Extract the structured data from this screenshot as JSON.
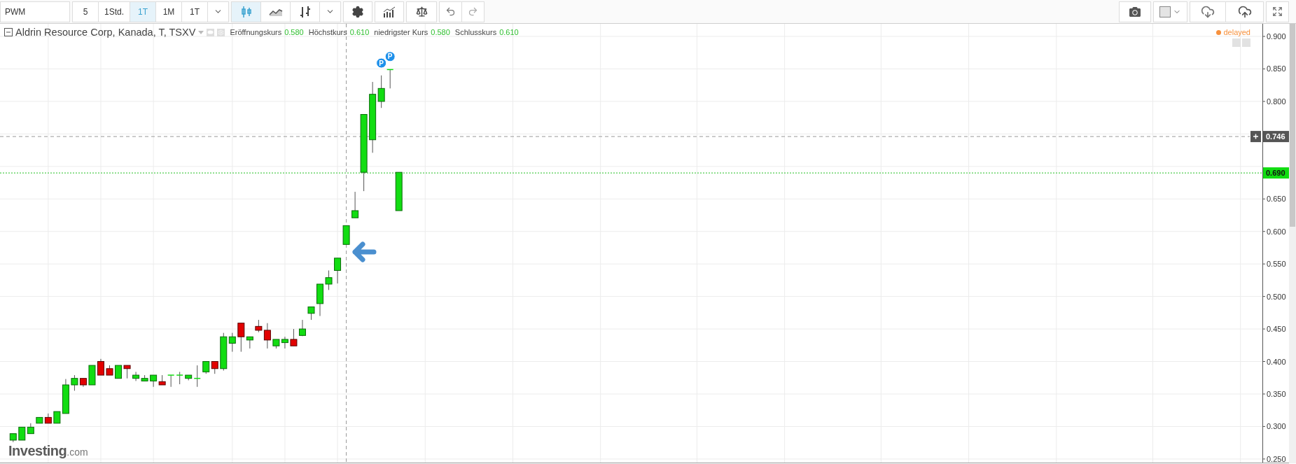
{
  "toolbar": {
    "symbol": "PWM",
    "intervals": [
      {
        "label": "5",
        "selected": false
      },
      {
        "label": "1Std.",
        "selected": false
      },
      {
        "label": "1T",
        "selected": true
      },
      {
        "label": "1M",
        "selected": false
      },
      {
        "label": "1T",
        "selected": false
      }
    ],
    "chart_types": [
      {
        "kind": "candles",
        "selected": true
      },
      {
        "kind": "line",
        "selected": false
      },
      {
        "kind": "bars",
        "selected": false
      }
    ]
  },
  "legend": {
    "title": "Aldrin Resource Corp, Kanada, T, TSXV",
    "fields": [
      {
        "label": "Eröffnungskurs",
        "value": "0.580"
      },
      {
        "label": "Höchstkurs",
        "value": "0.610"
      },
      {
        "label": "niedrigster Kurs",
        "value": "0.580"
      },
      {
        "label": "Schlusskurs",
        "value": "0.610"
      }
    ]
  },
  "status": {
    "label": "delayed",
    "color": "#f7913d"
  },
  "logo": {
    "name": "Investing",
    "suffix": ".com"
  },
  "chart_data": {
    "type": "candlestick",
    "grid": true,
    "ylim": [
      0.2434,
      0.9194
    ],
    "categories": [
      null,
      null,
      null,
      null,
      null,
      null,
      null,
      null,
      null,
      null,
      null,
      null,
      null,
      null,
      null,
      null,
      null,
      null,
      null,
      null,
      null,
      null,
      null,
      null,
      null,
      null,
      null,
      null,
      null,
      null,
      null,
      null,
      null,
      null,
      null,
      null,
      null,
      null,
      null,
      null,
      null,
      null,
      null,
      null,
      null,
      null,
      null,
      null,
      null,
      null,
      null,
      null,
      null,
      null,
      null,
      null,
      null,
      null,
      null,
      null,
      null,
      null,
      null,
      null,
      null,
      null,
      null,
      null,
      null,
      null,
      null,
      null,
      null,
      null,
      null,
      null,
      null,
      null,
      null,
      null,
      null,
      null,
      null,
      null,
      null,
      null,
      null,
      null,
      null,
      null,
      null,
      null,
      null,
      null,
      null,
      null,
      null,
      null,
      null,
      null,
      null,
      null,
      null,
      null,
      null,
      null,
      null,
      null,
      null,
      null,
      null,
      null,
      null,
      null,
      null,
      null,
      null,
      null,
      null,
      null,
      null,
      null,
      null,
      null,
      null,
      null,
      null,
      null,
      null,
      null,
      null,
      null,
      null,
      null,
      null,
      null,
      null,
      null,
      null,
      null,
      null,
      null,
      null,
      null
    ],
    "yticks": [
      {
        "value": 0.9,
        "label": "0.900"
      },
      {
        "value": 0.85,
        "label": "0.850"
      },
      {
        "value": 0.8,
        "label": "0.800"
      },
      {
        "value": 0.65,
        "label": "0.650"
      },
      {
        "value": 0.6,
        "label": "0.600"
      },
      {
        "value": 0.55,
        "label": "0.550"
      },
      {
        "value": 0.5,
        "label": "0.500"
      },
      {
        "value": 0.45,
        "label": "0.450"
      },
      {
        "value": 0.4,
        "label": "0.400"
      },
      {
        "value": 0.35,
        "label": "0.350"
      },
      {
        "value": 0.3,
        "label": "0.300"
      },
      {
        "value": 0.25,
        "label": "0.250"
      }
    ],
    "ohlc": [
      null,
      [
        0.279,
        0.289,
        0.276,
        0.289
      ],
      [
        0.279,
        0.299,
        0.279,
        0.299
      ],
      [
        0.289,
        0.305,
        0.289,
        0.299
      ],
      [
        0.305,
        0.314,
        0.305,
        0.314
      ],
      [
        0.314,
        0.32,
        0.305,
        0.305
      ],
      [
        0.305,
        0.323,
        0.305,
        0.323
      ],
      [
        0.32,
        0.373,
        0.32,
        0.364
      ],
      [
        0.364,
        0.379,
        0.355,
        0.374
      ],
      [
        0.374,
        0.374,
        0.361,
        0.364
      ],
      [
        0.364,
        0.394,
        0.364,
        0.394
      ],
      [
        0.4,
        0.404,
        0.379,
        0.379
      ],
      [
        0.389,
        0.394,
        0.379,
        0.379
      ],
      [
        0.374,
        0.394,
        0.374,
        0.394
      ],
      [
        0.394,
        0.394,
        0.374,
        0.389
      ],
      [
        0.374,
        0.384,
        0.37,
        0.379
      ],
      [
        0.37,
        0.379,
        0.37,
        0.374
      ],
      [
        0.37,
        0.379,
        0.361,
        0.379
      ],
      [
        0.369,
        0.379,
        0.364,
        0.364
      ],
      [
        0.379,
        0.379,
        0.361,
        0.379
      ],
      [
        0.379,
        0.384,
        0.365,
        0.379
      ],
      [
        0.374,
        0.379,
        0.371,
        0.379
      ],
      [
        0.374,
        0.394,
        0.361,
        0.374
      ],
      [
        0.384,
        0.4,
        0.381,
        0.4
      ],
      [
        0.4,
        0.4,
        0.381,
        0.389
      ],
      [
        0.389,
        0.444,
        0.386,
        0.438
      ],
      [
        0.428,
        0.444,
        0.415,
        0.438
      ],
      [
        0.459,
        0.459,
        0.415,
        0.438
      ],
      [
        0.433,
        0.438,
        0.42,
        0.438
      ],
      [
        0.454,
        0.464,
        0.445,
        0.448
      ],
      [
        0.448,
        0.459,
        0.42,
        0.433
      ],
      [
        0.424,
        0.434,
        0.42,
        0.434
      ],
      [
        0.429,
        0.438,
        0.42,
        0.434
      ],
      [
        0.434,
        0.45,
        0.424,
        0.424
      ],
      [
        0.44,
        0.464,
        0.439,
        0.45
      ],
      [
        0.474,
        0.484,
        0.464,
        0.484
      ],
      [
        0.489,
        0.519,
        0.47,
        0.519
      ],
      [
        0.519,
        0.54,
        0.51,
        0.529
      ],
      [
        0.54,
        0.559,
        0.52,
        0.559
      ],
      [
        0.58,
        0.609,
        0.58,
        0.609
      ],
      [
        0.621,
        0.661,
        0.621,
        0.632
      ],
      [
        0.691,
        0.78,
        0.662,
        0.78
      ],
      [
        0.741,
        0.83,
        0.721,
        0.811
      ],
      [
        0.8,
        0.84,
        0.79,
        0.82
      ],
      [
        0.849,
        0.849,
        0.82,
        0.849
      ],
      [
        0.632,
        0.691,
        0.632,
        0.691
      ],
      null,
      null,
      null,
      null,
      null,
      null,
      null,
      null,
      null,
      null,
      null,
      null,
      null,
      null,
      null,
      null,
      null,
      null,
      null,
      null,
      null,
      null,
      null,
      null,
      null,
      null,
      null,
      null,
      null,
      null,
      null,
      null,
      null,
      null,
      null,
      null,
      null,
      null,
      null,
      null,
      null,
      null,
      null,
      null,
      null,
      null,
      null,
      null,
      null,
      null,
      null,
      null,
      null,
      null,
      null,
      null,
      null,
      null,
      null,
      null,
      null,
      null,
      null,
      null,
      null,
      null,
      null,
      null,
      null,
      null,
      null,
      null,
      null,
      null,
      null,
      null,
      null,
      null,
      null,
      null,
      null,
      null,
      null,
      null,
      null,
      null,
      null,
      null,
      null,
      null,
      null,
      null,
      null,
      null,
      null,
      null,
      null,
      null
    ],
    "ref_lines": [
      {
        "axis": "y",
        "value": 0.746,
        "label": "0.746",
        "color": "#999999"
      },
      {
        "axis": "y",
        "value": 0.69,
        "label": "0.690",
        "color": "#22c022"
      }
    ],
    "annotations": [
      "P",
      "P"
    ]
  }
}
